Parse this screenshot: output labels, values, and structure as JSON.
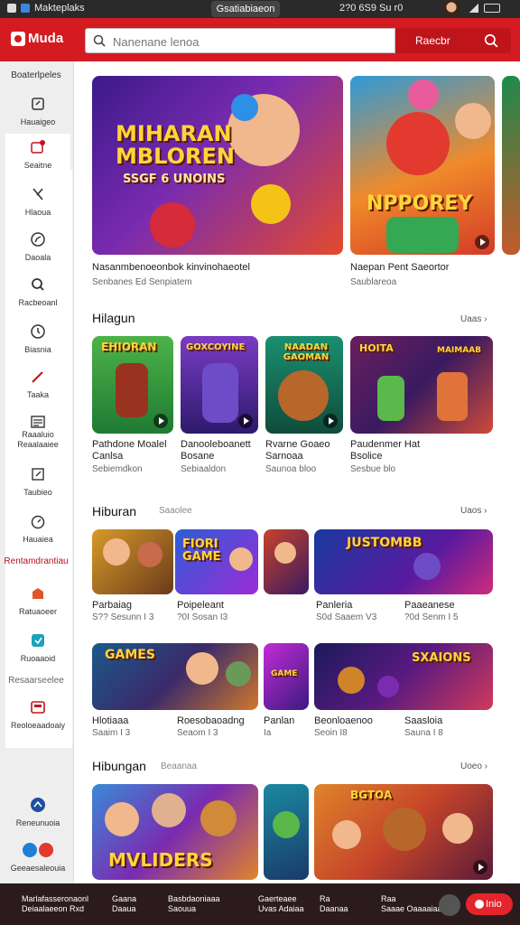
{
  "status_bar": {
    "app_name": "Makteplaks",
    "pill": "Gsatiabiaeon",
    "time": "2?0 6S9 Su r0"
  },
  "header": {
    "brand": "Muda",
    "search_placeholder": "Nanenane lenoa",
    "search_button": "Raecbr"
  },
  "sidebar": {
    "heading": "Boaterlpeles",
    "items": [
      {
        "label": "Hauaigeo",
        "icon": "pin-icon"
      },
      {
        "label": "Seaitne",
        "icon": "notification-icon"
      },
      {
        "label": "Hlaoua",
        "icon": "x-icon"
      },
      {
        "label": "Daoala",
        "icon": "compass-icon"
      },
      {
        "label": "Racbeoanl",
        "icon": "search-icon"
      },
      {
        "label": "Biasnia",
        "icon": "clock-icon"
      },
      {
        "label": "Taaka",
        "icon": "wand-icon"
      },
      {
        "label": "Raaaluio Reaalaaiee",
        "icon": "list-icon"
      },
      {
        "label": "Taubieo",
        "icon": "edit-icon"
      },
      {
        "label": "Hauaiea",
        "icon": "timer-icon"
      }
    ],
    "category_1": "Rentamdrantiau",
    "items_2": [
      {
        "label": "Ratuaoeer",
        "icon": "shop-icon"
      },
      {
        "label": "Ruoaaoid",
        "icon": "app-icon"
      }
    ],
    "category_2": "Resaarseelee",
    "items_3": [
      {
        "label": "Reoloeaadoaiy",
        "icon": "save-icon"
      }
    ],
    "bottom": [
      {
        "label": "Reneunuoia",
        "icon": "share-icon"
      },
      {
        "label": "Geeaesaleouia",
        "icon": "social-icon"
      }
    ]
  },
  "featured": [
    {
      "art": "MIHARAN MBLOREN",
      "art2": "SSGF 6 UNOINS",
      "title": "Nasanmbenoeonbok kinvinohaeotel",
      "subtitle": "Senbanes Ed Senpiatem"
    },
    {
      "art": "NPPOREY",
      "title": "Naepan Pent Saeortor",
      "subtitle": "Saublareoa"
    }
  ],
  "section_1": {
    "title": "Hilagun",
    "more": "Uaas ›",
    "cards": [
      {
        "art": "EHIORAN",
        "title": "Pathdone Moalel Canlsa",
        "subtitle": "Sebiemdkon"
      },
      {
        "art": "GOXCOYINE",
        "title": "Danooleboanett Bosane",
        "subtitle": "Sebiaaldon"
      },
      {
        "art": "NAADAN GAOMAN",
        "title": "Rvarne Goaeo Sarnoaa",
        "subtitle": "Saunoa bloo"
      },
      {
        "art": "HOITA",
        "art2": "MAIMAAB",
        "title": "Paudenmer Hat Bsolice",
        "subtitle": "Sesbue blo"
      }
    ]
  },
  "section_2": {
    "title": "Hiburan",
    "sub": "Saaolee",
    "more": "Uaos ›",
    "row1": [
      {
        "art": "",
        "title": "Parbaiag",
        "meta": "S?? Sesunn I 3"
      },
      {
        "art": "FIORI GAME",
        "title": "Poipeleant",
        "meta": "?0I Sosan I3"
      },
      {
        "art": "",
        "title": "Panleria",
        "meta": "S0d Saaem V3"
      },
      {
        "art": "JUSTOMBB",
        "title": "Paaeanese",
        "meta": "?0d Senm I 5"
      }
    ],
    "row2": [
      {
        "art": "GAMES",
        "title": "Hlotiaaa",
        "meta": "Saaim I 3"
      },
      {
        "art": "",
        "title": "Roesobaoadng",
        "meta": "Seaom I 3"
      },
      {
        "art": "GAME",
        "title": "Panlan",
        "meta": "Ia"
      },
      {
        "art": "SXAIONS",
        "title": "Beonloaenoo",
        "meta": "Seoin I8"
      },
      {
        "art": "",
        "title": "Saasloia",
        "meta": "Sauna I 8"
      }
    ]
  },
  "section_3": {
    "title": "Hibungan",
    "sub": "Beaanaa",
    "more": "Uoeo ›",
    "cards": [
      {
        "art": "MVLIDERS"
      },
      {
        "art": ""
      },
      {
        "art": "BGTOA"
      }
    ]
  },
  "bottom_bar": {
    "items": [
      {
        "l1": "Marlafasseronaonl",
        "l2": "Deiaalaeeon Rxd"
      },
      {
        "l1": "Gaana",
        "l2": "Daaua"
      },
      {
        "l1": "Basbdaoniaaa",
        "l2": "Saouua"
      },
      {
        "l1": "Gaerteaee",
        "l2": "Uvas Adaiaa"
      },
      {
        "l1": "Ra",
        "l2": "Daanaa"
      },
      {
        "l1": "Raa",
        "l2": "Saaae Oaaaaiaa"
      }
    ],
    "button": "Inio"
  }
}
